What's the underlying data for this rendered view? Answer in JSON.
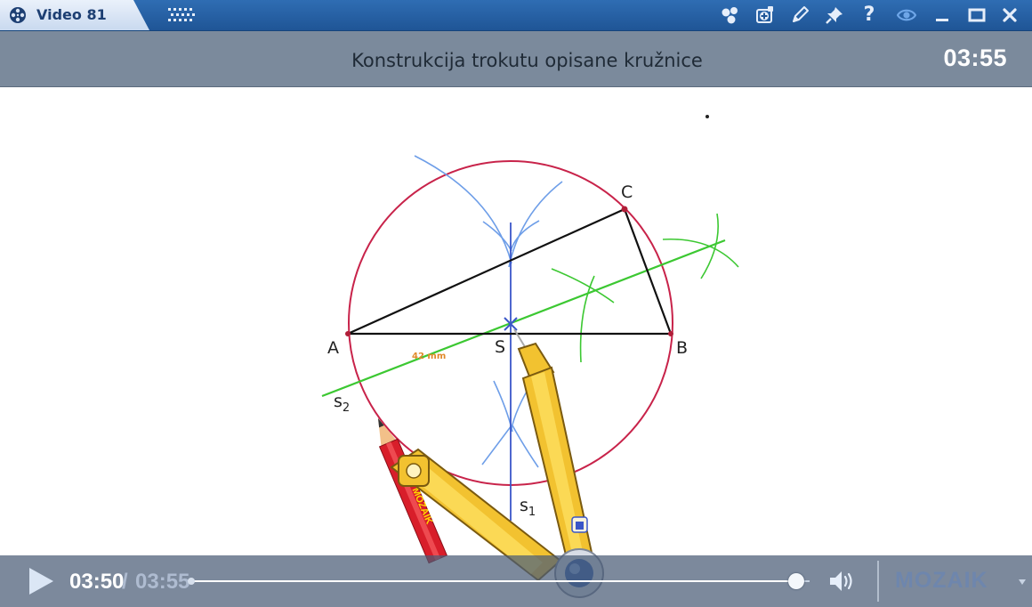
{
  "window": {
    "tab_label": "Video 81",
    "icons": [
      "film-reel-icon",
      "grid-icon",
      "molecule-icon",
      "add-icon",
      "pencil-icon",
      "pin-icon",
      "help-icon",
      "eye-icon",
      "minimize-icon",
      "maximize-icon",
      "close-icon"
    ],
    "help_glyph": "?"
  },
  "header": {
    "title": "Konstrukcija trokutu opisane kružnice",
    "duration": "03:55"
  },
  "drawing": {
    "point_labels": {
      "a": "A",
      "b": "B",
      "c": "C",
      "s": "S"
    },
    "line_labels": {
      "s1": "s",
      "s1_sub": "1",
      "s2": "s",
      "s2_sub": "2"
    },
    "measurement": "42   mm",
    "pencil_brand": "MOZAIK"
  },
  "player": {
    "current_time": "03:50",
    "separator": "/",
    "total_time": "03:55",
    "progress": 0.979,
    "volume_icon": "speaker-icon",
    "brand": "MOZAIK"
  },
  "colors": {
    "titlebar": "#2f6db3",
    "header": "#7b8a9c",
    "circle": "#c8234a",
    "perpendicular_bisector_1": "#3a56c8",
    "perpendicular_bisector_2": "#3cc832",
    "arc_blue": "#6e9ee8",
    "arc_green": "#3cc832"
  }
}
